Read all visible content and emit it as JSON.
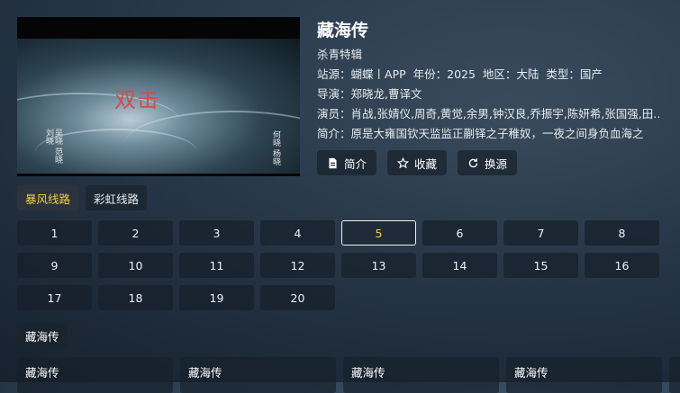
{
  "player": {
    "video_title": "双击",
    "cast_left": [
      "吴晓",
      "范晓",
      "刘晓",
      "刘晓"
    ],
    "cast_left_text": "吴晓 范晓 刘晓",
    "cast_right_text": "何晓 杨晓"
  },
  "detail": {
    "title": "藏海传",
    "subtitle": "杀青特辑",
    "site_label": "站源：",
    "site": "蝴蝶丨APP",
    "year_label": "年份：",
    "year": "2025",
    "region_label": "地区：",
    "region": "大陆",
    "type_label": "类型：",
    "type": "国产",
    "director_label": "导演：",
    "director": "郑晓龙,曹译文",
    "actors_label": "演员：",
    "actors": "肖战,张婧仪,周奇,黄觉,余男,钟汉良,乔振宇,陈妍希,张国强,田…",
    "intro_label": "简介：",
    "intro": "原是大雍国钦天监监正蒯铎之子稚奴，一夜之间身负血海之"
  },
  "actions": {
    "intro": "简介",
    "favorite": "收藏",
    "switch_source": "换源"
  },
  "sources": [
    "暴风线路",
    "彩虹线路"
  ],
  "active_source": 0,
  "episodes": [
    "1",
    "2",
    "3",
    "4",
    "5",
    "6",
    "7",
    "8",
    "9",
    "10",
    "11",
    "12",
    "13",
    "14",
    "15",
    "16",
    "17",
    "18",
    "19",
    "20"
  ],
  "current_episode": 4,
  "group_label": "藏海传",
  "related": [
    "藏海传",
    "藏海传",
    "藏海传",
    "藏海传"
  ],
  "colors": {
    "accent": "#f2cf4a",
    "title_red": "#d94a4a"
  }
}
